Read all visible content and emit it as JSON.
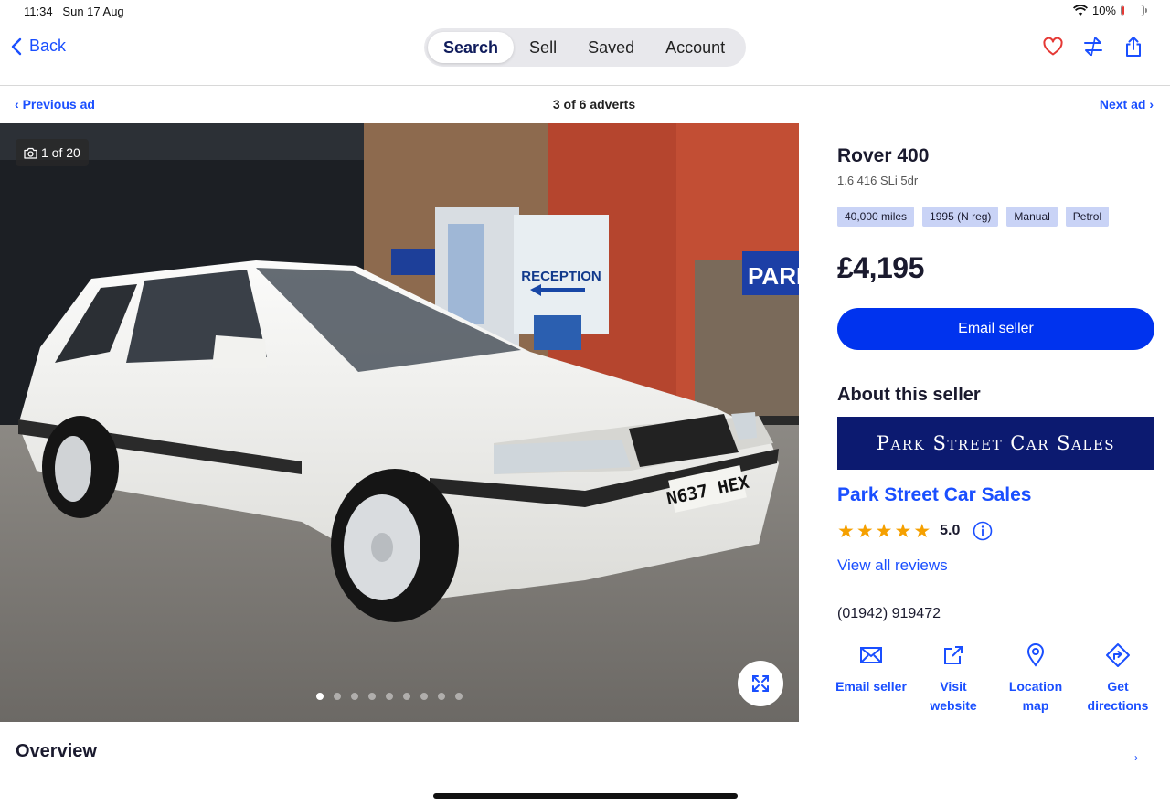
{
  "status": {
    "time": "11:34",
    "date": "Sun 17 Aug",
    "battery": "10%",
    "battery_level": 0.1
  },
  "nav": {
    "back": "Back",
    "tabs": [
      "Search",
      "Sell",
      "Saved",
      "Account"
    ],
    "active_tab": "Search",
    "icons": [
      "heart-icon",
      "compare-icon",
      "share-icon"
    ]
  },
  "adnav": {
    "previous": "Previous ad",
    "count": "3 of 6 adverts",
    "next": "Next ad"
  },
  "photo": {
    "counter": "1 of 20",
    "plate": "N637 HEX",
    "reception": "RECEPTION",
    "sign": "PARI",
    "dots": 9,
    "active_dot": 0
  },
  "listing": {
    "title": "Rover 400",
    "subtitle": "1.6 416 SLi 5dr",
    "tags": [
      "40,000 miles",
      "1995 (N reg)",
      "Manual",
      "Petrol"
    ],
    "price": "£4,195",
    "email_button": "Email seller"
  },
  "seller": {
    "heading": "About this seller",
    "banner": "Park Street Car Sales",
    "name": "Park Street Car Sales",
    "rating": "5.0",
    "stars": 5,
    "reviews_link": "View all reviews",
    "phone": "(01942) 919472",
    "actions": [
      {
        "label": "Email seller",
        "icon": "mail-icon"
      },
      {
        "label": "Visit website",
        "icon": "external-link-icon"
      },
      {
        "label": "Location map",
        "icon": "map-pin-icon"
      },
      {
        "label": "Get directions",
        "icon": "directions-icon"
      }
    ]
  },
  "overview": "Overview",
  "colors": {
    "accent": "#1a4fff",
    "button": "#0033ee",
    "tag_bg": "#c9d3f6",
    "banner_bg": "#0c1a70",
    "star": "#f5a000",
    "heart": "#e53935"
  }
}
